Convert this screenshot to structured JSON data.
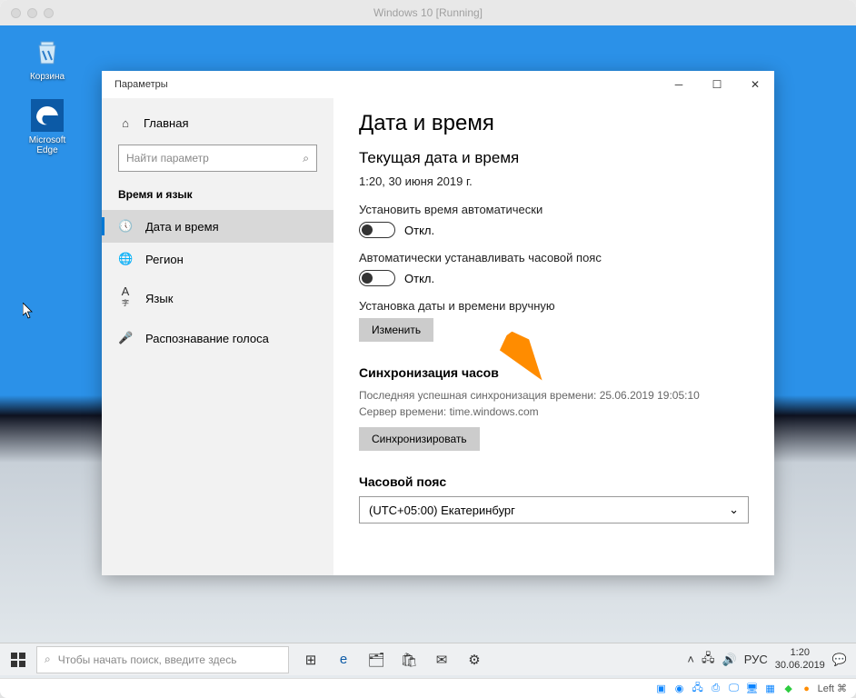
{
  "mac_title": "Windows 10 [Running]",
  "desktop": {
    "recycle_bin": "Корзина",
    "edge": "Microsoft Edge"
  },
  "settings": {
    "window_title": "Параметры",
    "home": "Главная",
    "search_placeholder": "Найти параметр",
    "category": "Время и язык",
    "nav": {
      "date_time": "Дата и время",
      "region": "Регион",
      "language": "Язык",
      "speech": "Распознавание голоса"
    },
    "page_title": "Дата и время",
    "current_heading": "Текущая дата и время",
    "current_value": "1:20, 30 июня 2019 г.",
    "auto_time_label": "Установить время автоматически",
    "auto_time_state": "Откл.",
    "auto_tz_label": "Автоматически устанавливать часовой пояс",
    "auto_tz_state": "Откл.",
    "manual_label": "Установка даты и времени вручную",
    "change_btn": "Изменить",
    "sync_heading": "Синхронизация часов",
    "sync_last": "Последняя успешная синхронизация времени: 25.06.2019 19:05:10",
    "sync_server": "Сервер времени: time.windows.com",
    "sync_btn": "Синхронизировать",
    "tz_heading": "Часовой пояс",
    "tz_value": "(UTC+05:00) Екатеринбург"
  },
  "taskbar": {
    "search_placeholder": "Чтобы начать поиск, введите здесь",
    "lang": "РУС",
    "time": "1:20",
    "date": "30.06.2019"
  },
  "host_status": "Left ⌘"
}
